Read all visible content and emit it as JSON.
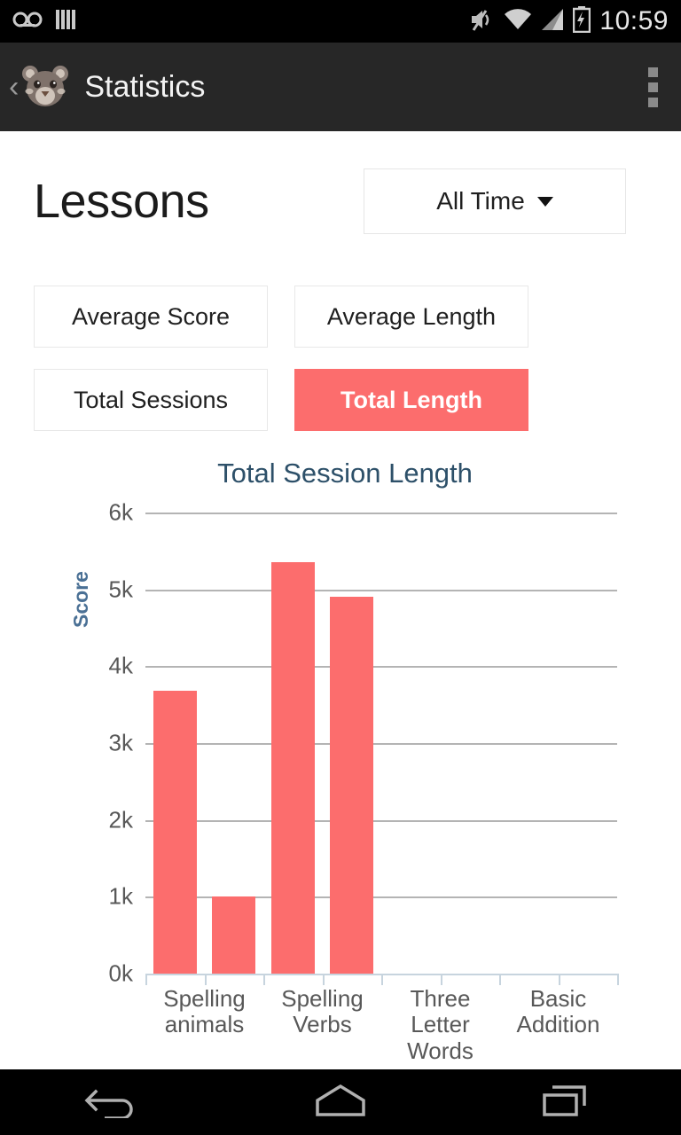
{
  "status_bar": {
    "icons": [
      "voicemail-icon",
      "barcode-icon"
    ],
    "right_icons": [
      "volume-muted-icon",
      "wifi-icon",
      "cellular-signal-icon",
      "battery-charging-icon"
    ],
    "clock": "10:59"
  },
  "app_bar": {
    "back_label": "‹",
    "avatar": "bear-avatar",
    "title": "Statistics",
    "overflow": "more-options-icon"
  },
  "page": {
    "title": "Lessons",
    "range_select": {
      "value": "All Time",
      "caret": "chevron-down-icon"
    },
    "metrics": [
      {
        "label": "Average Score",
        "active": false
      },
      {
        "label": "Average Length",
        "active": false
      },
      {
        "label": "Total Sessions",
        "active": false
      },
      {
        "label": "Total Length",
        "active": true
      }
    ]
  },
  "colors": {
    "accent": "#fc6d6d",
    "title_blue": "#2d5069",
    "axis_label_blue": "#4a7095",
    "gridline": "#b4b4b4",
    "axis_line": "#c7d4de",
    "appbar": "#272727",
    "statusbar": "#000000"
  },
  "chart_data": {
    "type": "bar",
    "title": "Total Session Length",
    "xlabel": "",
    "ylabel": "Score",
    "categories": [
      "Spelling animals",
      "Spelling Verbs",
      "Three Letter Words",
      "Basic Addition"
    ],
    "bar_slots": 8,
    "values": [
      3680,
      1000,
      5350,
      4900
    ],
    "bars": [
      {
        "label": "Spelling animals",
        "value": 3680,
        "slot": 0
      },
      {
        "label": "Spelling Verbs",
        "value": 1000,
        "slot": 1
      },
      {
        "label": "Three Letter Words",
        "value": 5350,
        "slot": 2
      },
      {
        "label": "Basic Addition",
        "value": 4900,
        "slot": 3
      }
    ],
    "yticks": [
      "0k",
      "1k",
      "2k",
      "3k",
      "4k",
      "5k",
      "6k"
    ],
    "ytick_values": [
      0,
      1000,
      2000,
      3000,
      4000,
      5000,
      6000
    ],
    "ylim": [
      0,
      6000
    ],
    "grid": true,
    "legend": false,
    "series_color": "#fc6d6d"
  },
  "nav_bar": {
    "buttons": [
      "back-icon",
      "home-icon",
      "recents-icon"
    ]
  }
}
